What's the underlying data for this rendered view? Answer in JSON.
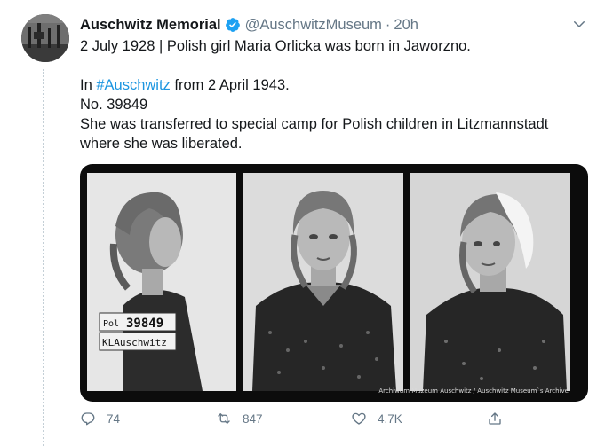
{
  "tweet": {
    "display_name": "Auschwitz Memorial",
    "handle": "@AuschwitzMuseum",
    "separator": "·",
    "time": "20h",
    "line1": "2 July 1928 | Polish girl Maria Orlicka was born in Jaworzno.",
    "line2_prefix": "In ",
    "hashtag": "#Auschwitz",
    "line2_suffix": " from 2 April 1943.",
    "line3": "No. 39849",
    "line4": "She was transferred to special camp for Polish children in Litzmannstadt",
    "line5": "where she was liberated."
  },
  "media": {
    "placard_number": "39849",
    "placard_prefix": "Pol",
    "placard_camp": "KLAuschwitz",
    "credit": "Archiwum Muzeum Auschwitz / Auschwitz Museum`s Archive"
  },
  "actions": {
    "replies": "74",
    "retweets": "847",
    "likes": "4.7K"
  },
  "colors": {
    "link": "#1b95e0",
    "muted": "#657786",
    "verified": "#1da1f2"
  }
}
